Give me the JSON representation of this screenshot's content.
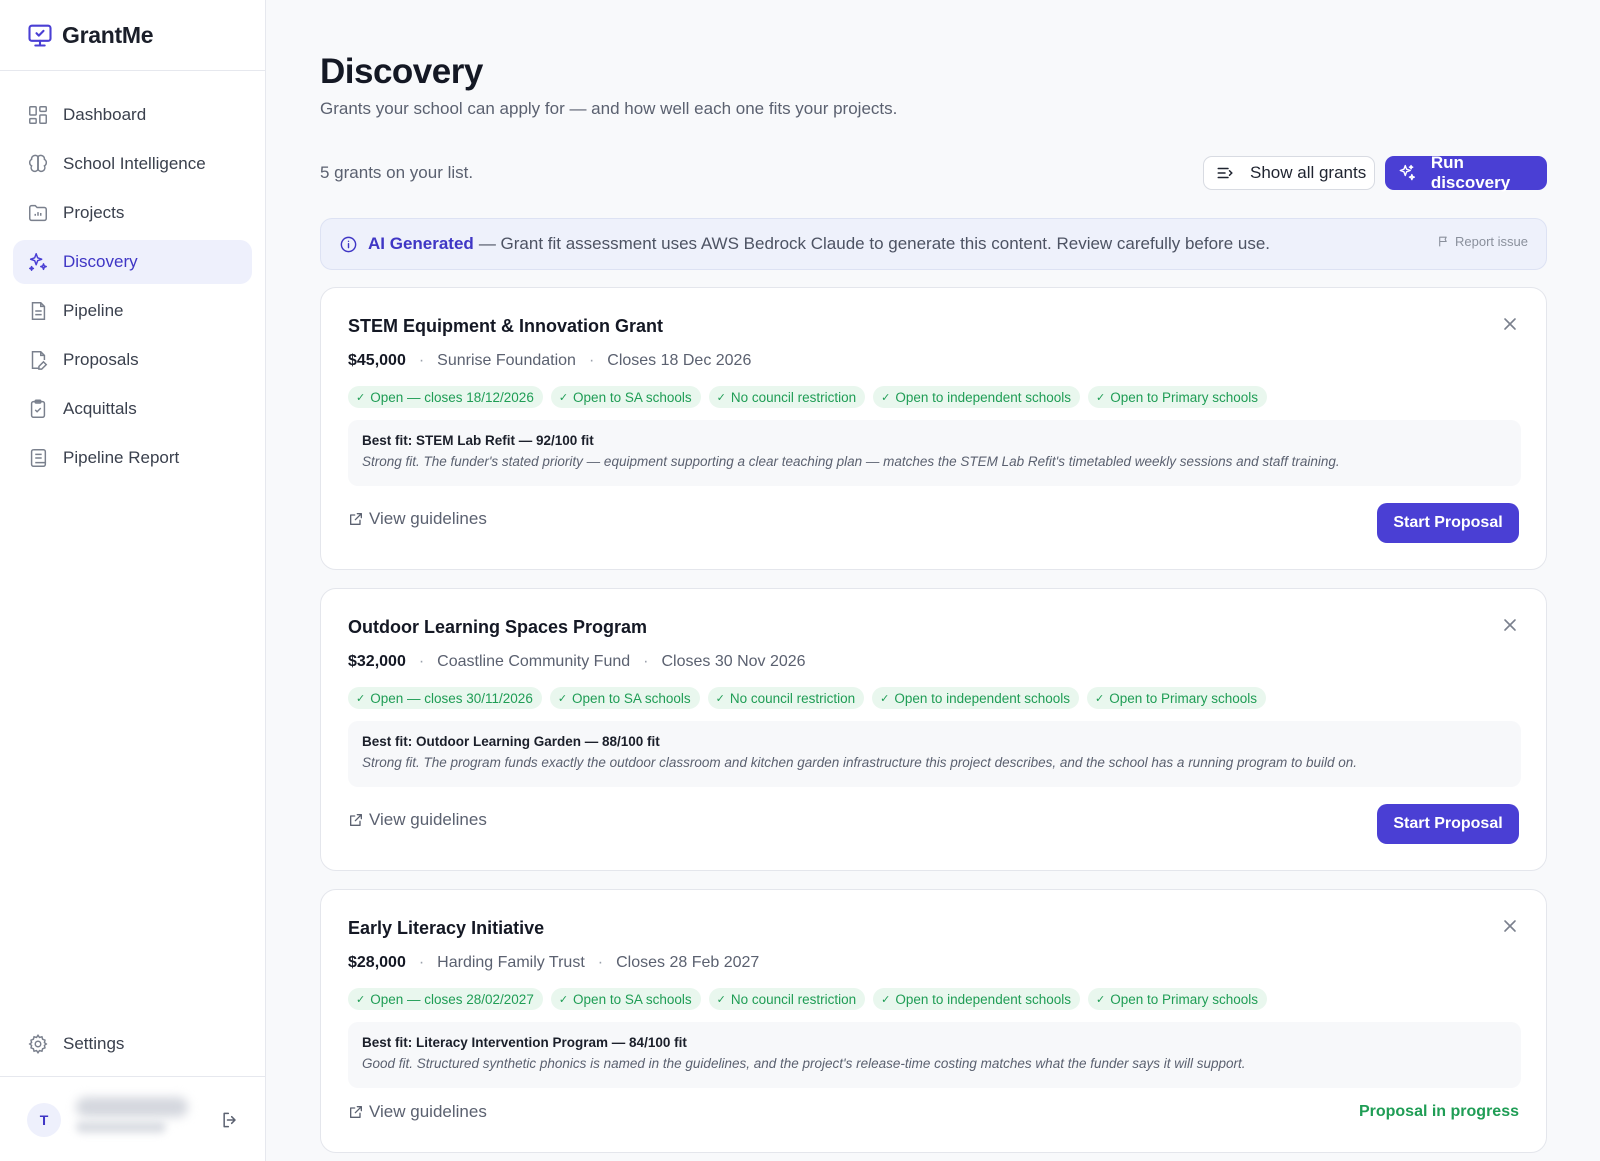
{
  "brand": {
    "name": "GrantMe"
  },
  "sidebar": {
    "items": [
      {
        "label": "Dashboard",
        "icon": "dashboard-icon",
        "active": false
      },
      {
        "label": "School Intelligence",
        "icon": "brain-icon",
        "active": false
      },
      {
        "label": "Projects",
        "icon": "folder-chart-icon",
        "active": false
      },
      {
        "label": "Discovery",
        "icon": "sparkles-icon",
        "active": true
      },
      {
        "label": "Pipeline",
        "icon": "document-icon",
        "active": false
      },
      {
        "label": "Proposals",
        "icon": "file-pen-icon",
        "active": false
      },
      {
        "label": "Acquittals",
        "icon": "clipboard-check-icon",
        "active": false
      },
      {
        "label": "Pipeline Report",
        "icon": "scroll-icon",
        "active": false
      }
    ],
    "settings_label": "Settings",
    "user": {
      "initial": "T"
    }
  },
  "page": {
    "title": "Discovery",
    "subtitle": "Grants your school can apply for — and how well each one fits your projects.",
    "count_text": "5 grants on your list.",
    "show_all_label": "Show all grants",
    "run_discovery_label": "Run discovery"
  },
  "ai_banner": {
    "strong": "AI Generated",
    "text": "— Grant fit assessment uses AWS Bedrock Claude to generate this content. Review carefully before use.",
    "report_label": "Report issue"
  },
  "grants": [
    {
      "title": "STEM Equipment & Innovation Grant",
      "amount": "$45,000",
      "funder": "Sunrise Foundation",
      "closes": "Closes 18 Dec 2026",
      "chips": [
        "Open — closes 18/12/2026",
        "Open to SA schools",
        "No council restriction",
        "Open to independent schools",
        "Open to Primary schools"
      ],
      "fit_title": "Best fit: STEM Lab Refit — 92/100 fit",
      "fit_desc": "Strong fit. The funder's stated priority — equipment supporting a clear teaching plan — matches the STEM Lab Refit's timetabled weekly sessions and staff training.",
      "guidelines_label": "View guidelines",
      "action_label": "Start Proposal"
    },
    {
      "title": "Outdoor Learning Spaces Program",
      "amount": "$32,000",
      "funder": "Coastline Community Fund",
      "closes": "Closes 30 Nov 2026",
      "chips": [
        "Open — closes 30/11/2026",
        "Open to SA schools",
        "No council restriction",
        "Open to independent schools",
        "Open to Primary schools"
      ],
      "fit_title": "Best fit: Outdoor Learning Garden — 88/100 fit",
      "fit_desc": "Strong fit. The program funds exactly the outdoor classroom and kitchen garden infrastructure this project describes, and the school has a running program to build on.",
      "guidelines_label": "View guidelines",
      "action_label": "Start Proposal"
    },
    {
      "title": "Early Literacy Initiative",
      "amount": "$28,000",
      "funder": "Harding Family Trust",
      "closes": "Closes 28 Feb 2027",
      "chips": [
        "Open — closes 28/02/2027",
        "Open to SA schools",
        "No council restriction",
        "Open to independent schools",
        "Open to Primary schools"
      ],
      "fit_title": "Best fit: Literacy Intervention Program — 84/100 fit",
      "fit_desc": "Good fit. Structured synthetic phonics is named in the guidelines, and the project's release-time costing matches what the funder says it will support.",
      "guidelines_label": "View guidelines",
      "status_label": "Proposal in progress"
    }
  ],
  "colors": {
    "accent": "#4a3fd4",
    "active_bg": "#eef0fc",
    "success": "#1f9d55",
    "chip_bg": "#e9f7ee"
  }
}
